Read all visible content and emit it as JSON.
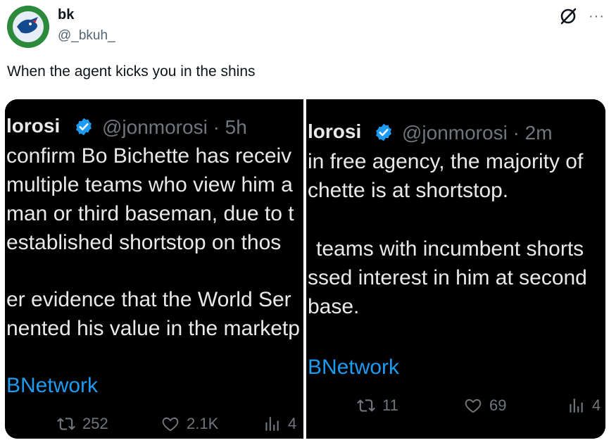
{
  "author": {
    "name": "bk",
    "handle": "@_bkuh_"
  },
  "tweet": {
    "text": "When the agent kicks you in the shins"
  },
  "colors": {
    "link": "#1d9bf0",
    "verified": "#1d9bf0",
    "avatar_bg": "#2c8a3a"
  },
  "icons": [
    "grok-icon",
    "more-icon",
    "verified-icon",
    "retweet-icon",
    "like-icon",
    "views-icon"
  ],
  "left_screenshot": {
    "name": "lorosi",
    "handle_time": "@jonmorosi · 5h",
    "lines": [
      "confirm Bo Bichette has receiv",
      "multiple teams who view him a",
      "man or third baseman, due to t",
      "established shortstop on thos",
      "er evidence that the World Ser",
      "nented his value in the marketp"
    ],
    "link": "BNetwork",
    "retweets": "252",
    "likes": "2.1K",
    "views": "4"
  },
  "right_screenshot": {
    "name": "lorosi",
    "handle_time": "@jonmorosi · 2m",
    "lines": [
      "in free agency, the majority of",
      "chette is at shortstop.",
      "teams with incumbent shorts",
      "ssed interest in him at second",
      "base."
    ],
    "link": "BNetwork",
    "retweets": "11",
    "likes": "69",
    "views": "4"
  }
}
